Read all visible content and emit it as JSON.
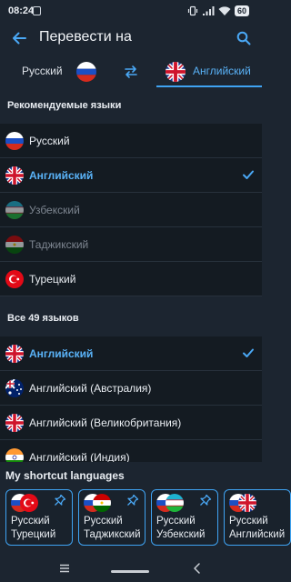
{
  "status": {
    "time": "08:24",
    "battery": "60"
  },
  "header": {
    "title": "Перевести на"
  },
  "switch": {
    "source": "Русский",
    "target": "Английский"
  },
  "recommended": {
    "heading": "Рекомендуемые языки",
    "items": [
      {
        "label": "Русский",
        "flag": "ru-flag-icon"
      },
      {
        "label": "Английский",
        "flag": "gb-flag-icon"
      },
      {
        "label": "Узбекский",
        "flag": "uz-flag-icon"
      },
      {
        "label": "Таджикский",
        "flag": "tj-flag-icon"
      },
      {
        "label": "Турецкий",
        "flag": "tr-flag-icon"
      }
    ]
  },
  "all": {
    "heading": "Все 49 языков",
    "items": [
      {
        "label": "Английский",
        "flag": "gb-flag-icon"
      },
      {
        "label": "Английский (Австралия)",
        "flag": "au-flag-icon"
      },
      {
        "label": "Английский (Великобритания)",
        "flag": "gb-flag-icon"
      },
      {
        "label": "Английский (Индия)",
        "flag": "in-flag-icon"
      }
    ]
  },
  "shortcuts": {
    "heading": "My shortcut languages",
    "cards": [
      {
        "from": "Русский",
        "to": "Турецкий"
      },
      {
        "from": "Русский",
        "to": "Таджикский"
      },
      {
        "from": "Русский",
        "to": "Узбекский"
      },
      {
        "from": "Русский",
        "to": "Английский"
      }
    ]
  },
  "colors": {
    "accent": "#3fa3f2",
    "background": "#1c2530",
    "row": "#141b22"
  }
}
